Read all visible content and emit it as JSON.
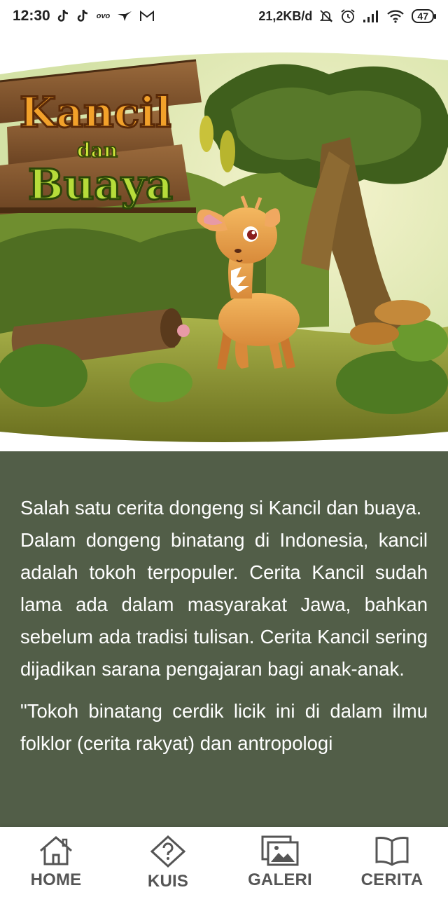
{
  "status_bar": {
    "time": "12:30",
    "ovo": "ovo",
    "speed": "21,2KB/d",
    "battery": "47",
    "icons": [
      "tiktok-icon",
      "tiktok-icon",
      "ovo-icon",
      "bird-icon",
      "gmail-icon",
      "bell-off-icon",
      "alarm-icon",
      "signal-icon",
      "wifi-icon",
      "battery-icon"
    ]
  },
  "hero": {
    "title_line1": "Kancil",
    "title_line2": "dan",
    "title_line3": "Buaya"
  },
  "story": {
    "paragraph1": "Salah satu cerita dongeng si Kancil dan buaya.\nDalam dongeng binatang di Indonesia, kancil adalah tokoh terpopuler. Cerita Kancil sudah lama ada dalam masyarakat Jawa, bahkan sebelum ada tradisi tulisan. Cerita Kancil sering dijadikan sarana pengajaran bagi anak-anak.",
    "paragraph2": "\"Tokoh binatang cerdik licik ini di dalam ilmu folklor (cerita rakyat) dan antropologi"
  },
  "nav": {
    "home": "HOME",
    "kuis": "KUIS",
    "galeri": "GALERI",
    "cerita": "CERITA"
  },
  "colors": {
    "panel": "#525e48",
    "nav_icon": "#555555",
    "text": "#ffffff"
  }
}
